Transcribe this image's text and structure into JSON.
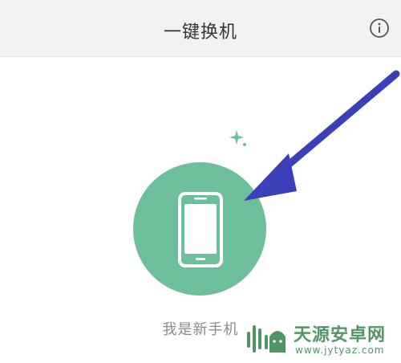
{
  "header": {
    "title": "一键换机",
    "info_icon": "info-circle-icon"
  },
  "main": {
    "role_button": {
      "icon": "smartphone-icon",
      "label": "我是新手机"
    },
    "sparkle_icon": "sparkle-icon"
  },
  "annotation": {
    "arrow_color": "#3b3fb8"
  },
  "watermark": {
    "name": "天源安卓网",
    "url": "www.jytyaz.com"
  },
  "colors": {
    "header_bg": "#f2f2f2",
    "accent_green": "#6cbf9a",
    "watermark_green": "#3f8a56"
  }
}
